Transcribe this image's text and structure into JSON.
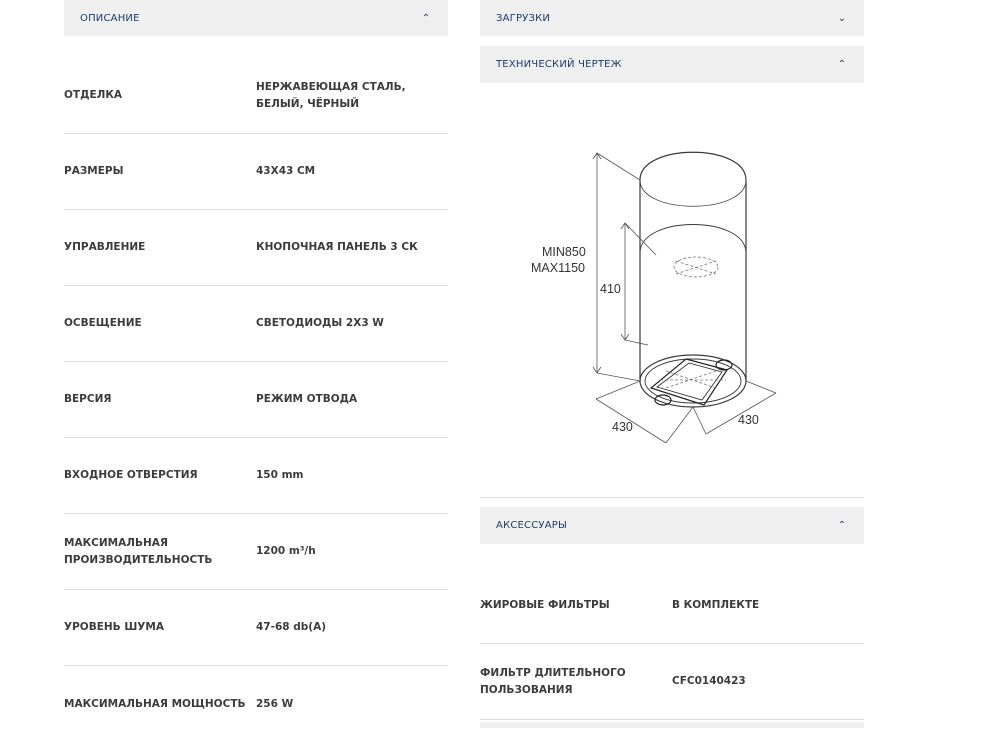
{
  "left": {
    "header": {
      "title": "ОПИСАНИЕ",
      "chevron": "chevron-up-icon"
    },
    "specs": [
      {
        "label": "ОТДЕЛКА",
        "value": "НЕРЖАВЕЮЩАЯ СТАЛЬ, БЕЛЫЙ, ЧЁРНЫЙ"
      },
      {
        "label": "РАЗМЕРЫ",
        "value": "43X43 CM"
      },
      {
        "label": "УПРАВЛЕНИЕ",
        "value": "КНОПОЧНАЯ ПАНЕЛЬ 3 СК"
      },
      {
        "label": "ОСВЕЩЕНИЕ",
        "value": "СВЕТОДИОДЫ 2X3 W"
      },
      {
        "label": "ВЕРСИЯ",
        "value": "РЕЖИМ ОТВОДА"
      },
      {
        "label": "ВХОДНОЕ ОТВЕРСТИЯ",
        "value": "150 mm"
      },
      {
        "label": "МАКСИМАЛЬНАЯ ПРОИЗВОДИТЕЛЬНОСТЬ",
        "value": "1200 m³/h"
      },
      {
        "label": "УРОВЕНЬ ШУМА",
        "value": "47-68 db(A)"
      },
      {
        "label": "МАКСИМАЛЬНАЯ МОЩНОСТЬ",
        "value": "256 W"
      }
    ]
  },
  "right": {
    "downloads": {
      "title": "ЗАГРУЗКИ",
      "chevron": "chevron-down-icon"
    },
    "technical": {
      "title": "ТЕХНИЧЕСКИЙ ЧЕРТЕЖ",
      "chevron": "chevron-up-icon"
    },
    "drawing": {
      "min_label": "MIN850",
      "max_label": "MAX1150",
      "inner_height": "410",
      "width_left": "430",
      "width_right": "430"
    },
    "accessories": {
      "title": "АКСЕССУАРЫ",
      "chevron": "chevron-up-icon"
    },
    "acc_specs": [
      {
        "label": "ЖИРОВЫЕ ФИЛЬТРЫ",
        "value": "В КОМПЛЕКТЕ"
      },
      {
        "label": "ФИЛЬТР ДЛИТЕЛЬНОГО ПОЛЬЗОВАНИЯ",
        "value": "CFC0140423"
      }
    ]
  },
  "colors": {
    "header_bg": "#efefef",
    "header_text": "#1e3c68",
    "divider": "#dcdcdc"
  }
}
